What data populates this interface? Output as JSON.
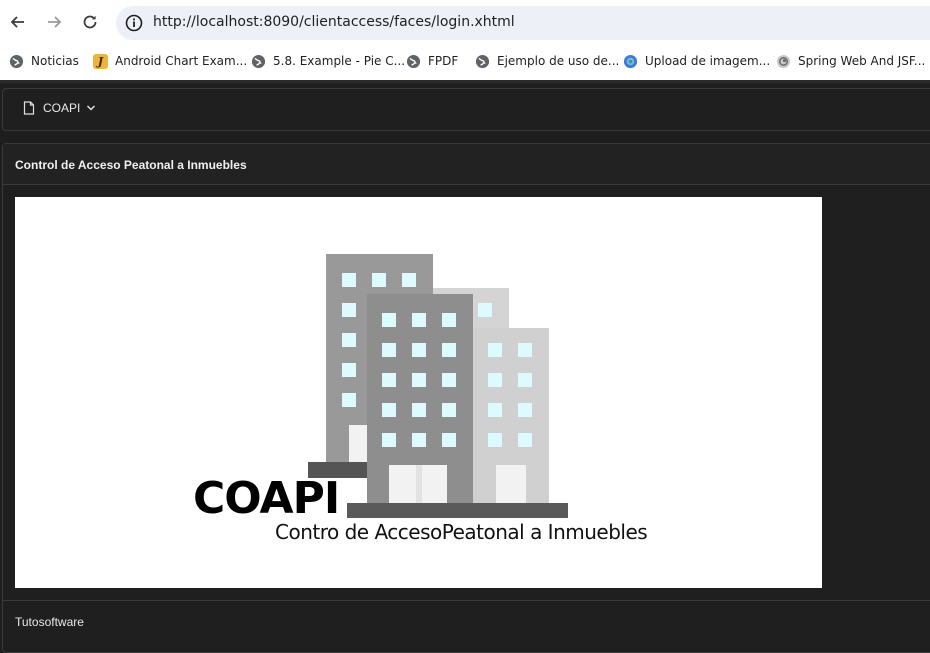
{
  "browser": {
    "url": "http://localhost:8090/clientaccess/faces/login.xhtml",
    "bookmarks": [
      {
        "label": "Noticias",
        "icon": "globe-icon"
      },
      {
        "label": "Android Chart Exam...",
        "icon": "j-badge-icon"
      },
      {
        "label": "5.8. Example - Pie C...",
        "icon": "globe-icon"
      },
      {
        "label": "FPDF",
        "icon": "globe-icon"
      },
      {
        "label": "Ejemplo de uso de...",
        "icon": "globe-icon"
      },
      {
        "label": "Upload de imagem...",
        "icon": "blue-globe-icon"
      },
      {
        "label": "Spring Web And JSF...",
        "icon": "gray-swirl-icon"
      }
    ],
    "bookmark_badge_letter": "J"
  },
  "menubar": {
    "item_label": "COAPI"
  },
  "panel": {
    "title": "Control de Acceso Peatonal a Inmuebles",
    "footer": "Tutosoftware"
  },
  "logo": {
    "name": "COAPI",
    "subtitle": "Contro de AccesoPeatonal a Inmuebles"
  },
  "colors": {
    "dark_bg": "#1e1e1e",
    "window": "#d9faff",
    "building_dark": "#8e8e8e",
    "building_mid": "#999999",
    "building_light": "#cfcfcf"
  }
}
